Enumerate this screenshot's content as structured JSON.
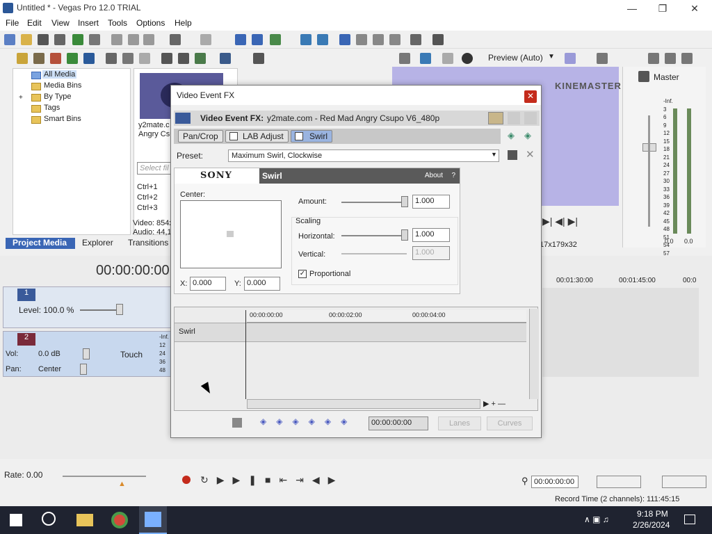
{
  "window": {
    "title": "Untitled * - Vegas Pro 12.0 TRIAL"
  },
  "menu": [
    "File",
    "Edit",
    "View",
    "Insert",
    "Tools",
    "Options",
    "Help"
  ],
  "explorer": {
    "tree": [
      "All Media",
      "Media Bins",
      "By Type",
      "Tags",
      "Smart Bins"
    ],
    "media_name": "y2mate.c",
    "media_name2": "Angry Csu",
    "search_placeholder": "Select fil",
    "shortcuts": [
      "Ctrl+1",
      "Ctrl+2",
      "Ctrl+3"
    ],
    "video_info": "Video: 854x",
    "audio_info": "Audio: 44,1",
    "tabs": [
      "Project Media",
      "Explorer",
      "Transitions"
    ]
  },
  "preview": {
    "label": "Preview (Auto)",
    "watermark": "KINEMASTER",
    "info": "17x179x32"
  },
  "mixer": {
    "label": "Master",
    "scale": [
      "-Inf.",
      "-Inf.",
      "3",
      "6",
      "9",
      "12",
      "15",
      "18",
      "21",
      "24",
      "27",
      "30",
      "33",
      "36",
      "39",
      "42",
      "45",
      "48",
      "51",
      "54",
      "57"
    ],
    "bottom_left": "0.0",
    "bottom_right": "0.0"
  },
  "timeline": {
    "timecode": "00:00:00:00",
    "ruler": [
      "00:01:30:00",
      "00:01:45:00",
      "00:0"
    ],
    "track1": {
      "num": "1",
      "level": "Level: 100.0 %"
    },
    "track2": {
      "num": "2",
      "vol_label": "Vol:",
      "vol_value": "0.0 dB",
      "pan_label": "Pan:",
      "pan_value": "Center",
      "mode": "Touch",
      "meter": [
        "-Inf.",
        "12",
        "24",
        "36",
        "48"
      ]
    },
    "rate": "Rate: 0.00",
    "transport_time": "00:00:00:00",
    "record_time": "Record Time (2 channels): 111:45:15"
  },
  "dialog": {
    "title": "Video Event FX",
    "fx_label": "Video Event FX:",
    "fx_name": "y2mate.com - Red Mad Angry Csupo V6_480p",
    "chain": [
      "Pan/Crop",
      "LAB Adjust",
      "Swirl"
    ],
    "preset_label": "Preset:",
    "preset_value": "Maximum Swirl, Clockwise",
    "plugin": {
      "brand": "SONY",
      "name": "Swirl",
      "about": "About",
      "help": "?",
      "center_label": "Center:",
      "x_label": "X:",
      "x_value": "0.000",
      "y_label": "Y:",
      "y_value": "0.000",
      "amount_label": "Amount:",
      "amount_value": "1.000",
      "scaling_label": "Scaling",
      "horizontal_label": "Horizontal:",
      "horizontal_value": "1.000",
      "vertical_label": "Vertical:",
      "vertical_value": "1.000",
      "proportional_label": "Proportional"
    },
    "keyframes": {
      "ruler": [
        "00:00:00:00",
        "00:00:02:00",
        "00:00:04:00"
      ],
      "row_label": "Swirl",
      "time": "00:00:00:00",
      "lanes": "Lanes",
      "curves": "Curves"
    }
  },
  "taskbar": {
    "time": "9:18 PM",
    "date": "2/26/2024"
  },
  "colors": {
    "accent": "#2b5797",
    "close_red": "#c42b1c",
    "preview_bg": "#b7b3e6",
    "taskbar": "#1f2330"
  }
}
